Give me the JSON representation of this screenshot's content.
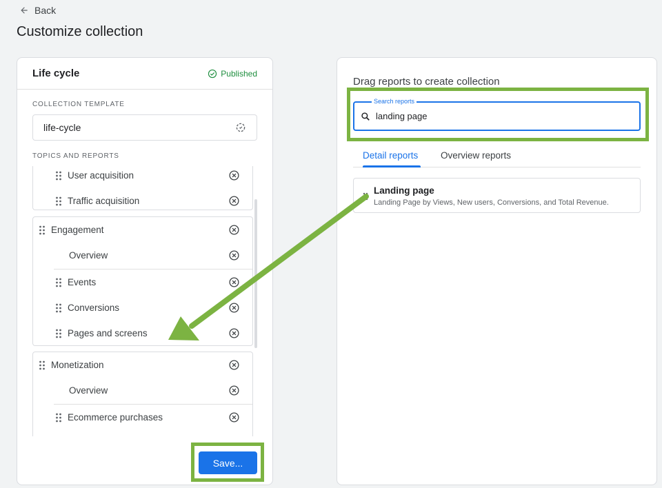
{
  "back_label": "Back",
  "page_title": "Customize collection",
  "left_panel": {
    "title": "Life cycle",
    "status": "Published",
    "collection_template_label": "COLLECTION TEMPLATE",
    "template_value": "life-cycle",
    "topics_label": "TOPICS AND REPORTS",
    "groups": [
      {
        "items": [
          "User acquisition",
          "Traffic acquisition"
        ]
      },
      {
        "name": "Engagement",
        "items": [
          "Overview",
          "Events",
          "Conversions",
          "Pages and screens"
        ]
      },
      {
        "name": "Monetization",
        "items": [
          "Overview",
          "Ecommerce purchases"
        ]
      }
    ],
    "save_label": "Save..."
  },
  "right_panel": {
    "title": "Drag reports to create collection",
    "search_label": "Search reports",
    "search_value": "landing page",
    "tabs": [
      "Detail reports",
      "Overview reports"
    ],
    "results": [
      {
        "title": "Landing page",
        "description": "Landing Page by Views, New users, Conversions, and Total Revenue."
      }
    ]
  },
  "colors": {
    "accent": "#1a73e8",
    "highlight": "#7cb342",
    "published": "#1e8e3e"
  }
}
